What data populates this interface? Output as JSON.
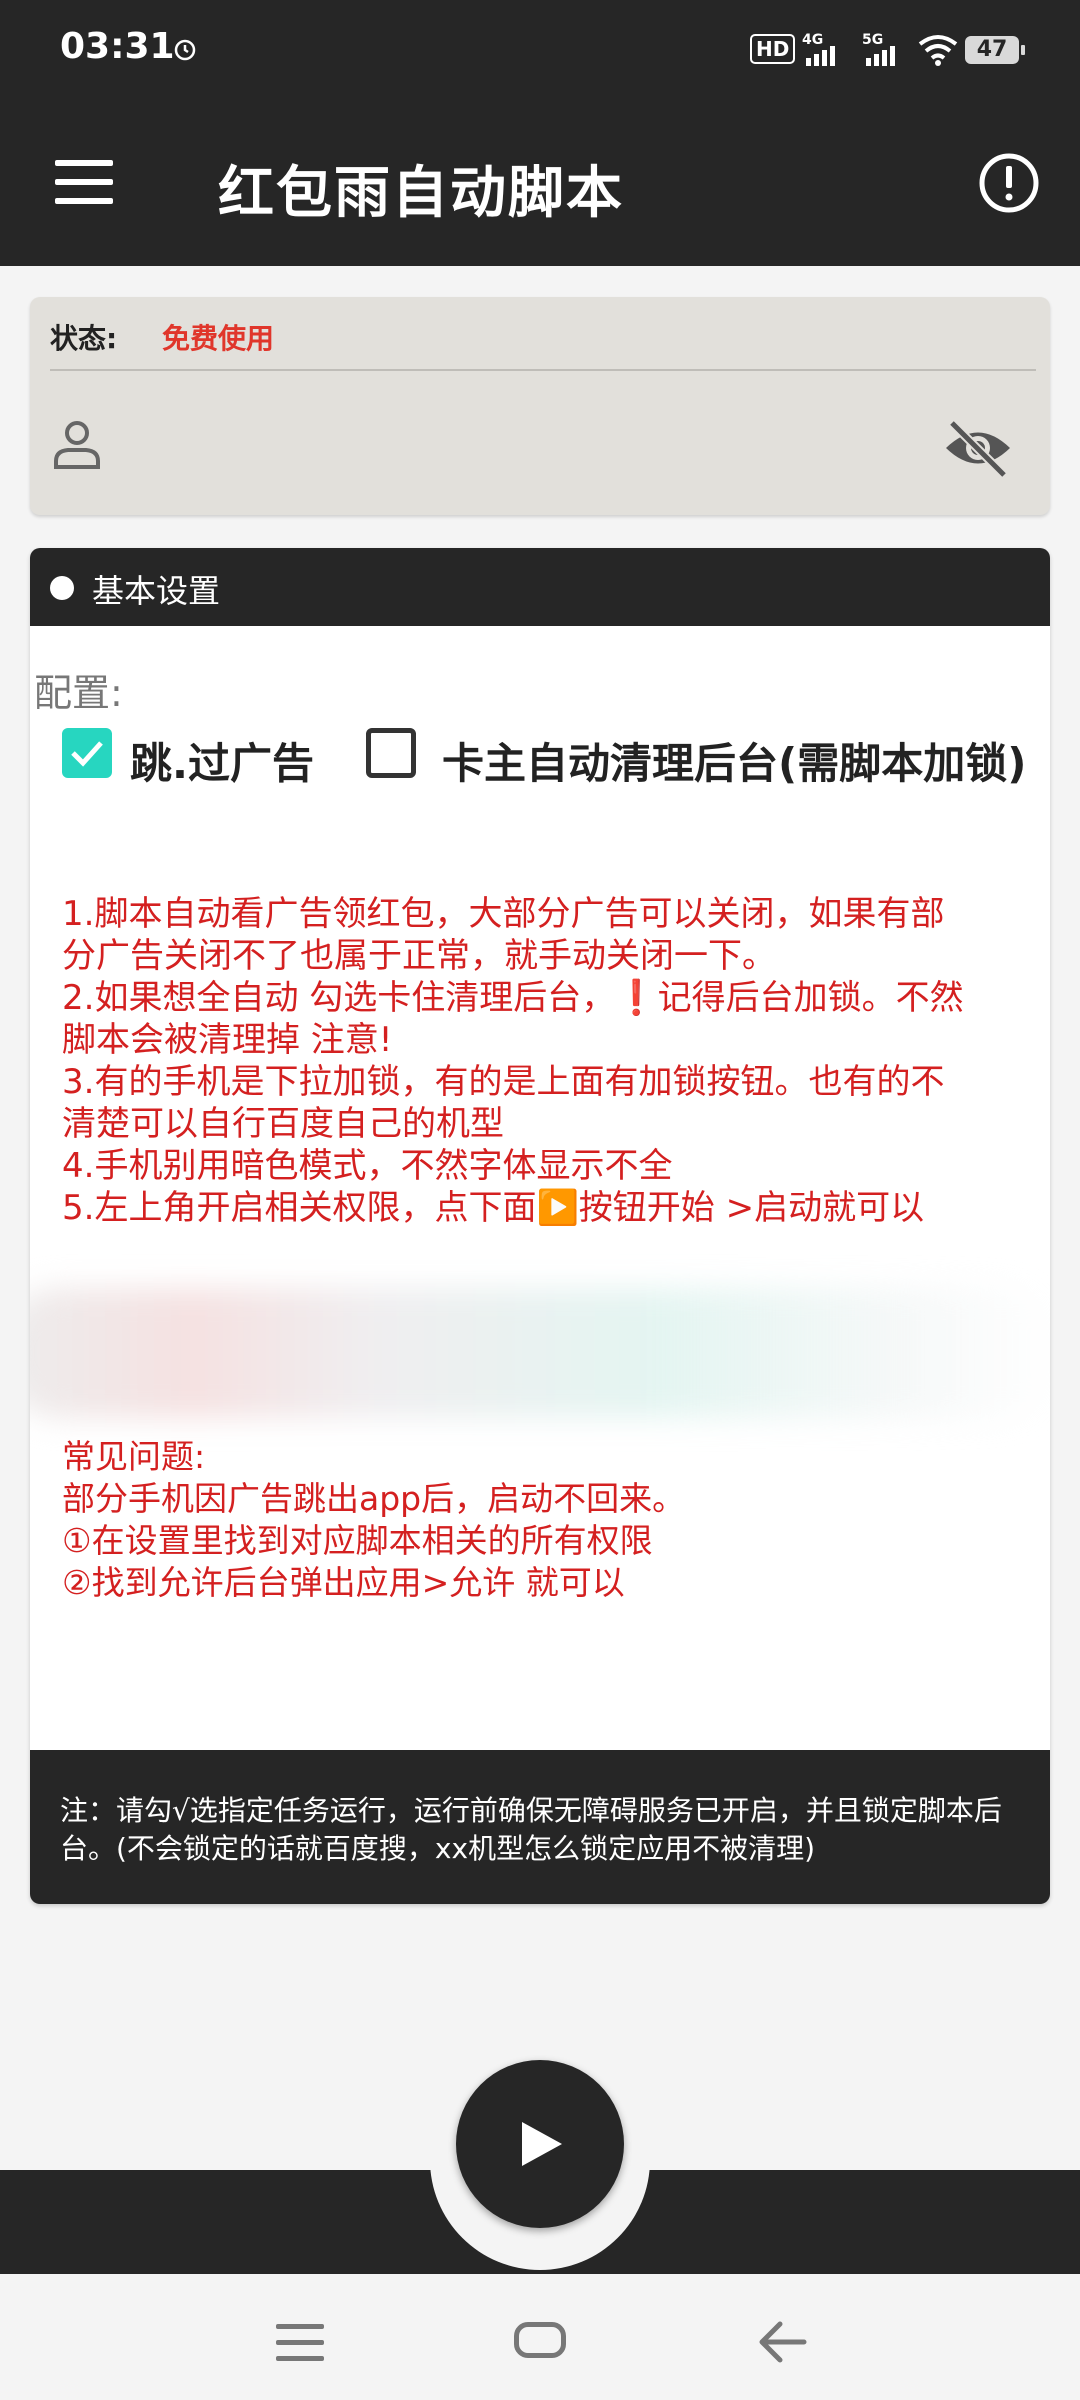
{
  "status_bar": {
    "time": "03:31",
    "network_hd": "HD",
    "net_a": "4G",
    "net_b": "5G",
    "battery": "47"
  },
  "app_bar": {
    "title": "红包雨自动脚本"
  },
  "status_card": {
    "label": "状态:",
    "value": "免费使用"
  },
  "settings": {
    "header": "基本设置",
    "config_label": "配置:",
    "options": [
      {
        "label": "跳.过广告",
        "checked": true
      },
      {
        "label": "卡主自动清理后台(需脚本加锁)",
        "checked": false
      }
    ],
    "instructions": [
      "1.脚本自动看广告领红包，大部分广告可以关闭，如果有部",
      "分广告关闭不了也属于正常，就手动关闭一下。",
      "2.如果想全自动 勾选卡住清理后台，❗记得后台加锁。不然",
      "脚本会被清理掉 注意!",
      "3.有的手机是下拉加锁，有的是上面有加锁按钮。也有的不",
      "清楚可以自行百度自己的机型",
      "4.手机别用暗色模式，不然字体显示不全",
      "5.左上角开启相关权限，点下面▶️按钮开始 >启动就可以"
    ],
    "faq": [
      "常见问题:",
      "部分手机因广告跳出app后，启动不回来。",
      "①在设置里找到对应脚本相关的所有权限",
      "②找到允许后台弹出应用>允许 就可以"
    ],
    "note": "注：请勾√选指定任务运行，运行前确保无障碍服务已开启，并且锁定脚本后台。(不会锁定的话就百度搜，xx机型怎么锁定应用不被清理)"
  },
  "colors": {
    "dark": "#262626",
    "accent_red": "#e0362b",
    "check_teal": "#27d6c0"
  }
}
